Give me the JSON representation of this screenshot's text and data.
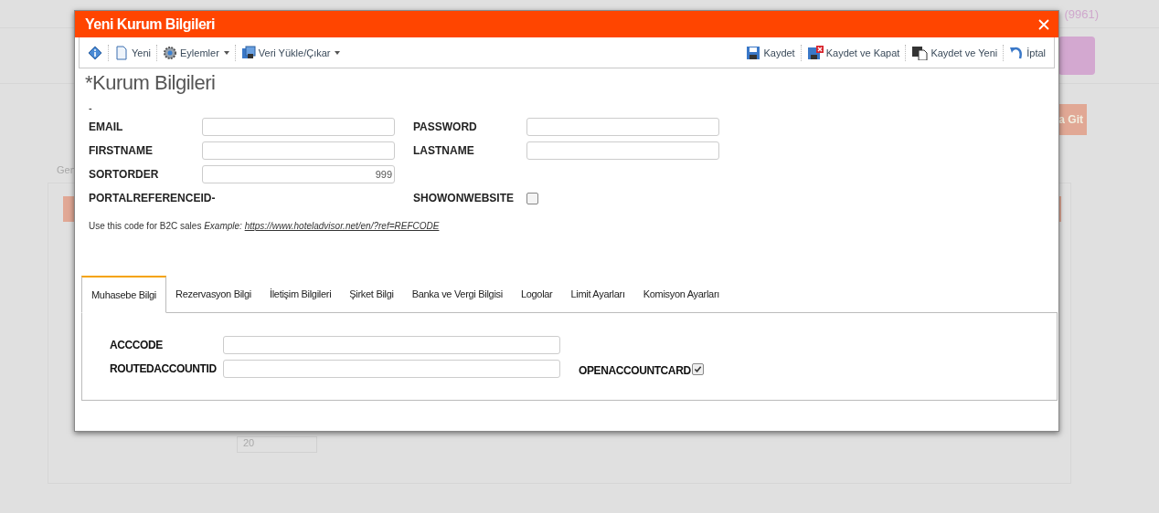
{
  "background": {
    "account": "(9961)",
    "button": "a Git",
    "breadcrumb": "Gen",
    "page_size": "20"
  },
  "dialog": {
    "title": "Yeni Kurum Bilgileri"
  },
  "toolbar": {
    "left": [
      {
        "kind": "info"
      },
      {
        "kind": "new",
        "label": "Yeni"
      },
      {
        "kind": "gear",
        "label": "Eylemler",
        "dropdown": true
      },
      {
        "kind": "import",
        "label": "Veri Yükle/Çıkar",
        "dropdown": true
      }
    ],
    "right": [
      {
        "kind": "save",
        "label": "Kaydet"
      },
      {
        "kind": "save-close",
        "label": "Kaydet ve Kapat"
      },
      {
        "kind": "save-new",
        "label": "Kaydet ve Yeni"
      },
      {
        "kind": "undo",
        "label": "İptal"
      }
    ]
  },
  "heading": "*Kurum Bilgileri",
  "subtitle": "-",
  "form_rows": [
    [
      {
        "kind": "input",
        "label": "EMAIL"
      },
      {
        "kind": "input",
        "label": "PASSWORD"
      }
    ],
    [
      {
        "kind": "input",
        "label": "FIRSTNAME"
      },
      {
        "kind": "input",
        "label": "LASTNAME"
      }
    ],
    [
      {
        "kind": "input",
        "label": "SORTORDER",
        "value": "999"
      }
    ],
    [
      {
        "kind": "text",
        "label": "PORTALREFERENCEID",
        "value": "-"
      },
      {
        "kind": "checkbox",
        "label": "SHOWONWEBSITE",
        "checked": false
      }
    ]
  ],
  "note": {
    "text": "Use this code for B2C sales",
    "example": "Example:",
    "link": "https://www.hoteladvisor.net/en/?ref=REFCODE"
  },
  "tabs": [
    {
      "label": "Muhasebe Bilgi",
      "selected": true
    },
    {
      "label": "Rezervasyon Bilgi",
      "selected": false
    },
    {
      "label": "İletişim Bilgileri",
      "selected": false
    },
    {
      "label": "Şirket Bilgi",
      "selected": false
    },
    {
      "label": "Banka ve Vergi Bilgisi",
      "selected": false
    },
    {
      "label": "Logolar",
      "selected": false
    },
    {
      "label": "Limit Ayarları",
      "selected": false
    },
    {
      "label": "Komisyon Ayarları",
      "selected": false
    }
  ],
  "tab_rows": [
    [
      {
        "kind": "input",
        "label": "ACCCODE"
      }
    ],
    [
      {
        "kind": "input",
        "label": "ROUTEDACCOUNTID"
      },
      {
        "kind": "checkbox",
        "label": "OPENACCOUNTCARD",
        "checked": true
      }
    ]
  ]
}
